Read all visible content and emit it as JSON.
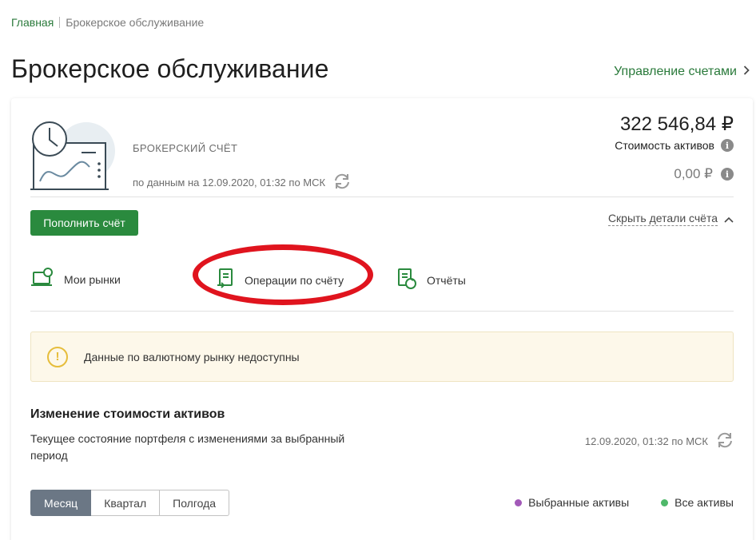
{
  "breadcrumb": {
    "home": "Главная",
    "current": "Брокерское обслуживание"
  },
  "page_title": "Брокерское обслуживание",
  "manage_link": "Управление счетами",
  "account": {
    "type": "БРОКЕРСКИЙ СЧЁТ",
    "date": "по данным на 12.09.2020, 01:32 по МСК",
    "balance": "322 546,84 ₽",
    "assets_label": "Стоимость активов",
    "secondary_value": "0,00 ₽"
  },
  "actions": {
    "topup": "Пополнить счёт",
    "hide_details": "Скрыть детали счёта"
  },
  "tabs": [
    {
      "label": "Мои рынки",
      "icon": "laptop-user-icon"
    },
    {
      "label": "Операции по счёту",
      "icon": "document-transfer-icon"
    },
    {
      "label": "Отчёты",
      "icon": "report-refresh-icon"
    }
  ],
  "warning": {
    "text": "Данные по валютному рынку недоступны",
    "icon": "warning-icon"
  },
  "asset_change": {
    "title": "Изменение стоимости активов",
    "description": "Текущее состояние портфеля с изменениями за выбранный период",
    "date": "12.09.2020, 01:32 по МСК",
    "periods": [
      "Месяц",
      "Квартал",
      "Полгода"
    ],
    "active_period": "Месяц",
    "legend": [
      {
        "label": "Выбранные активы",
        "color": "#a259b8"
      },
      {
        "label": "Все активы",
        "color": "#4fb86a"
      }
    ]
  },
  "colors": {
    "accent": "#2a7a3b",
    "button": "#2a8a3e",
    "highlight": "#e0141e",
    "warning": "#e6bd3b"
  }
}
